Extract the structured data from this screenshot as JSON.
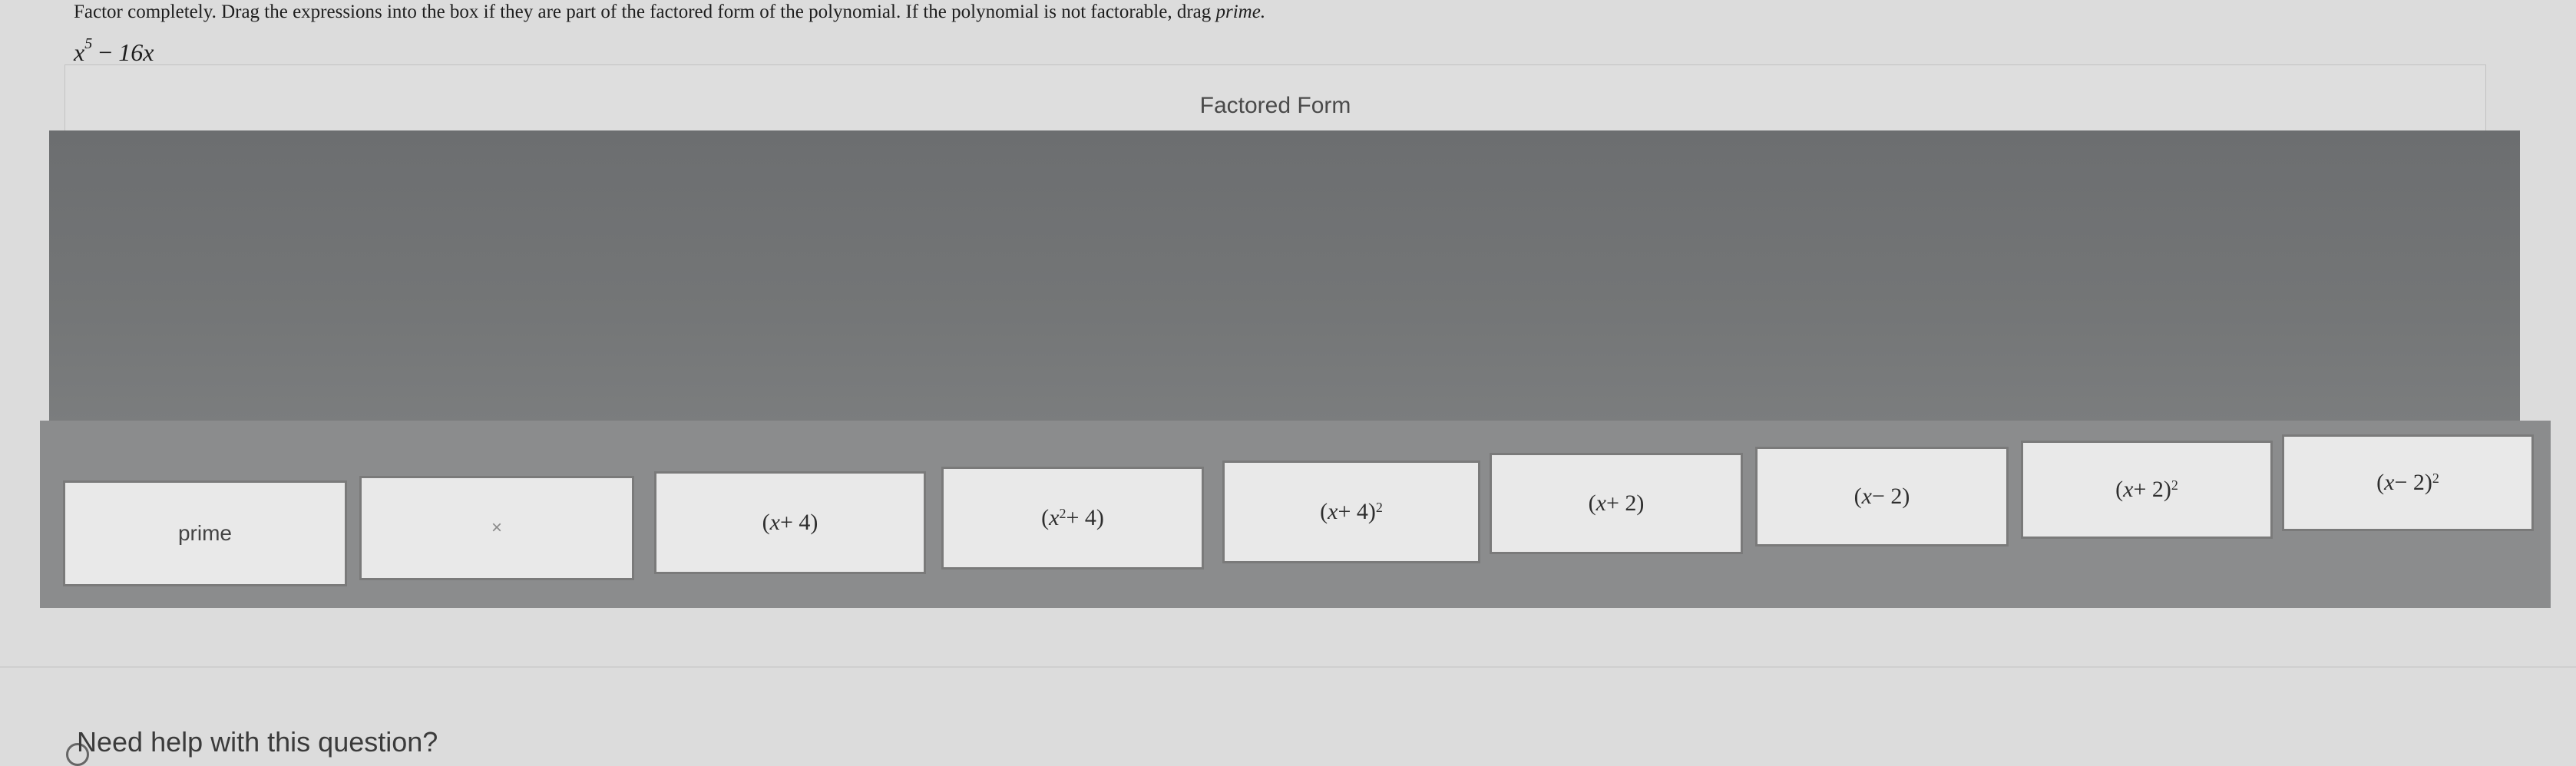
{
  "question": {
    "prompt": "Factor completely. Drag the expressions into the box if they are part of the factored form of the polynomial. If the polynomial is not factorable, drag",
    "emphasis": "prime.",
    "polynomial": {
      "base": "x",
      "exponent": "5",
      "operator": "−",
      "term": "16x"
    }
  },
  "factored_box": {
    "label": "Factored Form"
  },
  "tiles": {
    "prime": {
      "label": "prime"
    },
    "times": {
      "label": "×"
    },
    "x_plus_4": {
      "open": "(",
      "var": "x",
      "op": " + 4",
      "close": ")"
    },
    "x2_plus_4": {
      "open": "(",
      "var": "x",
      "exp": "2",
      "op": " + 4",
      "close": ")"
    },
    "x_plus_4_sq": {
      "open": "(",
      "var": "x",
      "op": " + 4",
      "close": ")",
      "exp": "2"
    },
    "x_plus_2": {
      "open": "(",
      "var": "x",
      "op": " + 2",
      "close": ")"
    },
    "x_minus_2": {
      "open": "(",
      "var": "x",
      "op": " − 2",
      "close": ")"
    },
    "x_plus_2_sq": {
      "open": "(",
      "var": "x",
      "op": " + 2",
      "close": ")",
      "exp": "2"
    },
    "x_minus_2_sq": {
      "open": "(",
      "var": "x",
      "op": " − 2",
      "close": ")",
      "exp": "2"
    }
  },
  "help": {
    "label": "Need help with this question?"
  }
}
